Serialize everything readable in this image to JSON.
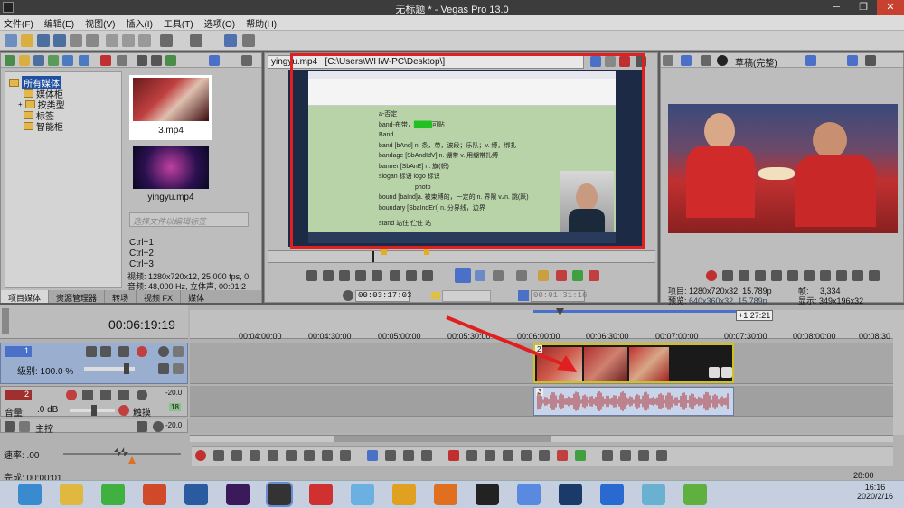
{
  "window": {
    "title": "无标题 * - Vegas Pro 13.0"
  },
  "menu": [
    "文件(F)",
    "编辑(E)",
    "视图(V)",
    "插入(I)",
    "工具(T)",
    "选项(O)",
    "帮助(H)"
  ],
  "explorer": {
    "tree": [
      "所有媒体",
      "媒体柜",
      "按类型",
      "标签",
      "智能柜"
    ],
    "media": [
      {
        "name": "3.mp4"
      },
      {
        "name": "yingyu.mp4"
      }
    ],
    "tag_placeholder": "选择文件以编辑标签",
    "shortcuts": [
      "Ctrl+1",
      "Ctrl+2",
      "Ctrl+3"
    ],
    "info_video": "视频: 1280x720x12, 25.000 fps, 0",
    "info_audio": "音频: 48,000 Hz, 立体声, 00:01:2",
    "tabs": [
      "项目媒体",
      "资源管理器",
      "转场",
      "视频 FX",
      "媒体"
    ]
  },
  "trimmer": {
    "file": "yingyu.mp4",
    "path": "[C:\\Users\\WHW-PC\\Desktop\\]",
    "time_in": "00:03:17:03",
    "time_out": "00:01:31:16",
    "doc_lines": [
      "a-否定",
      "band-布带，",
      "Band",
      "band [bAnd]  n. 条，带，波段；乐队；v. 缚，绑扎",
      "bandage [SbAndIdV]  n. 绷带 v. 用绷带扎缚",
      "banner  [SbAnE]  n. 旗(帜)",
      "slogan 标语  logo  标识",
      "photo",
      "bound   [baInd]a. 被束缚的，一定的  n. 界限 v./n. 跳(跃)",
      "boundary [SbaIndErI]  n. 分界线，边界",
      "stand  站住  伫住  站"
    ],
    "highlight_text": "可贴"
  },
  "preview": {
    "quality": "草稿(完整)",
    "project_label": "项目:",
    "project_value": "1280x720x32, 15.789p",
    "preview_label": "预览:",
    "preview_value": "640x360x32, 15.789p",
    "frame_label": "帧:",
    "frame_value": "3,334",
    "display_label": "显示:",
    "display_value": "349x196x32"
  },
  "timeline": {
    "current_time": "00:06:19:19",
    "region_length": "+1:27:21",
    "ruler": [
      "00:04:00:00",
      "00:04:30:00",
      "00:05:00:00",
      "00:05:30:00",
      "00:06:00:00",
      "00:06:30:00",
      "00:07:00:00",
      "00:07:30:00",
      "00:08:00:00",
      "00:08:30"
    ],
    "track1": {
      "num": "1",
      "level": "级别: 100.0 %"
    },
    "track2": {
      "num": "2",
      "volume": "音量:",
      "volume_val": ".0 dB",
      "pan": "触摸",
      "meter_top": "-20.0",
      "meter_mid": "18",
      "meter_bot": "-20.0"
    },
    "master": {
      "label": "主控"
    },
    "rate": "速率: .00",
    "clip_badge_video": "2",
    "clip_badge_audio": "3",
    "end_time": "28:00",
    "status": "完成: 00:00:01"
  },
  "taskbar": {
    "time": "16:16",
    "date": "2020/2/16"
  },
  "colors": {
    "annotation": "#e02020",
    "selection": "#4a70c8",
    "doc_bg": "#b9d3a8"
  }
}
